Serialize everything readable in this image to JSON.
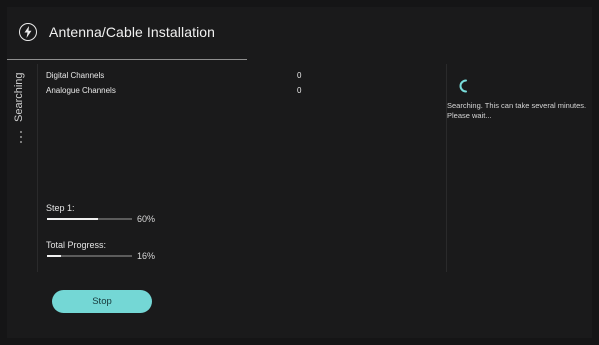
{
  "header": {
    "title": "Antenna/Cable Installation",
    "icon": "power-plug-icon"
  },
  "sidebar": {
    "tab_label": "Searching"
  },
  "channels": [
    {
      "label": "Digital Channels",
      "value": "0"
    },
    {
      "label": "Analogue Channels",
      "value": "0"
    }
  ],
  "progress": {
    "step": {
      "label": "Step 1:",
      "percent_text": "60%",
      "fraction": 0.6
    },
    "total": {
      "label": "Total Progress:",
      "percent_text": "16%",
      "fraction": 0.16
    }
  },
  "info": {
    "spinner_icon": "loading-spinner-icon",
    "message": "Searching. This can take several minutes. Please wait..."
  },
  "actions": {
    "stop_label": "Stop"
  },
  "colors": {
    "accent": "#74d7d5",
    "background": "#1a1a1b"
  }
}
